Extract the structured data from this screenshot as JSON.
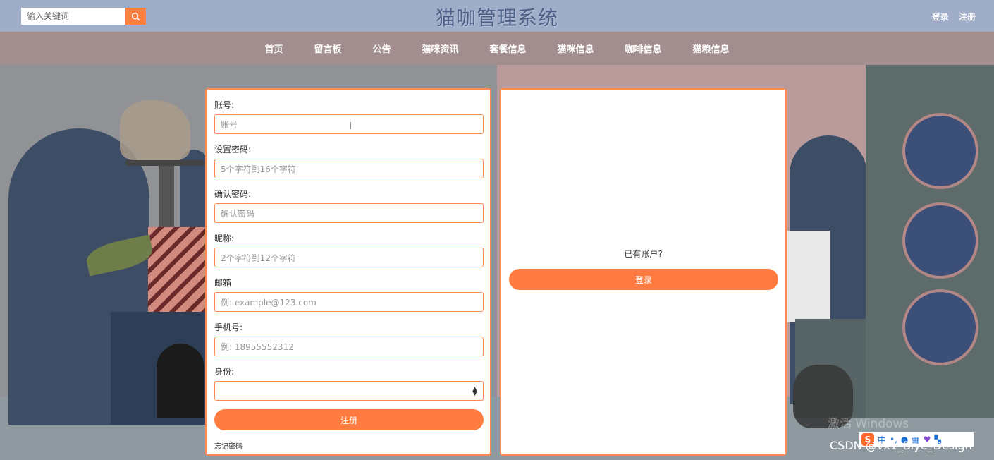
{
  "header": {
    "title": "猫咖管理系统",
    "search_placeholder": "输入关键词",
    "login_link": "登录",
    "register_link": "注册"
  },
  "nav": {
    "items": [
      "首页",
      "留言板",
      "公告",
      "猫咪资讯",
      "套餐信息",
      "猫咪信息",
      "咖啡信息",
      "猫粮信息"
    ]
  },
  "register_form": {
    "account_label": "账号:",
    "account_placeholder": "账号",
    "password_label": "设置密码:",
    "password_placeholder": "5个字符到16个字符",
    "confirm_label": "确认密码:",
    "confirm_placeholder": "确认密码",
    "nickname_label": "昵称:",
    "nickname_placeholder": "2个字符到12个字符",
    "email_label": "邮箱",
    "email_placeholder": "例: example@123.com",
    "phone_label": "手机号:",
    "phone_placeholder": "例: 18955552312",
    "role_label": "身份:",
    "role_value": "",
    "submit_label": "注册",
    "forgot_label": "忘记密码"
  },
  "login_panel": {
    "prompt": "已有账户?",
    "login_button": "登录"
  },
  "overlay": {
    "windows_watermark": "激活 Windows",
    "csdn_watermark": "CSDN @vx1_Biye_Design",
    "ime_text": "中"
  },
  "colors": {
    "accent": "#ff7b40",
    "header_bg": "#9fadc9",
    "nav_bg": "#a28e8e",
    "title": "#4c5f86"
  }
}
